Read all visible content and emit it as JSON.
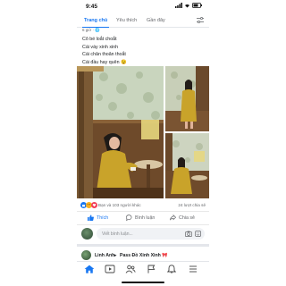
{
  "status": {
    "time": "9:45"
  },
  "tabs": [
    {
      "label": "Trang chủ",
      "active": true
    },
    {
      "label": "Yêu thích",
      "active": false
    },
    {
      "label": "Gần đây",
      "active": false
    }
  ],
  "post": {
    "time_label": "6 giờ",
    "caption_lines": [
      "Cô bé loắt choắt",
      "Cái váy xinh xinh",
      "Cái chân thoăn thoắt",
      "Cái đầu hay quên 😉"
    ],
    "reactions_text": "Bạn và 103 người khác",
    "shares_text": "24 lượt chia sẻ",
    "actions": {
      "like": "Thích",
      "comment": "Bình luận",
      "share": "Chia sẻ"
    },
    "comment_placeholder": "Viết bình luận...",
    "colors": {
      "accent": "#1877f2",
      "dress": "#c9a32a"
    }
  },
  "next_post": {
    "author": "Linh Anh",
    "group": "Pass Đồ Xinh Xinh 🎀"
  }
}
